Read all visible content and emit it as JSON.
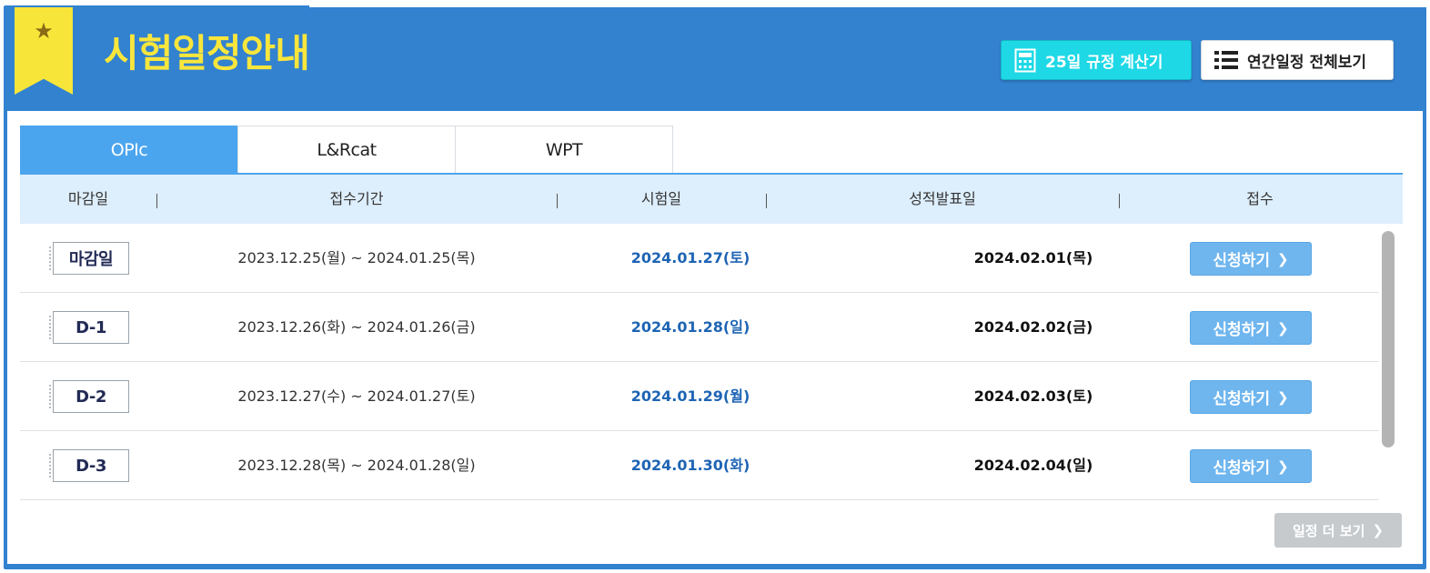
{
  "header": {
    "title": "시험일정안내",
    "calc_button": "25일 규정 계산기",
    "year_button": "연간일정 전체보기",
    "colors": {
      "panel": "#3282d0",
      "ribbon": "#f8e53a",
      "title": "#f9e63c",
      "calc": "#1ed8e6"
    },
    "icons": {
      "ribbon": "star-icon",
      "calc": "calculator-icon",
      "year": "list-icon"
    }
  },
  "tabs": [
    {
      "label": "OPIc",
      "active": true
    },
    {
      "label": "L&Rcat",
      "active": false
    },
    {
      "label": "WPT",
      "active": false
    }
  ],
  "table": {
    "headers": [
      "마감일",
      "접수기간",
      "시험일",
      "성적발표일",
      "접수"
    ],
    "rows": [
      {
        "badge": "마감일",
        "period": "2023.12.25(월) ~ 2024.01.25(목)",
        "exam": "2024.01.27(토)",
        "result": "2024.02.01(목)",
        "apply": "신청하기"
      },
      {
        "badge": "D-1",
        "period": "2023.12.26(화) ~ 2024.01.26(금)",
        "exam": "2024.01.28(일)",
        "result": "2024.02.02(금)",
        "apply": "신청하기"
      },
      {
        "badge": "D-2",
        "period": "2023.12.27(수) ~ 2024.01.27(토)",
        "exam": "2024.01.29(월)",
        "result": "2024.02.03(토)",
        "apply": "신청하기"
      },
      {
        "badge": "D-3",
        "period": "2023.12.28(목) ~ 2024.01.28(일)",
        "exam": "2024.01.30(화)",
        "result": "2024.02.04(일)",
        "apply": "신청하기"
      }
    ]
  },
  "more_button": "일정 더 보기"
}
